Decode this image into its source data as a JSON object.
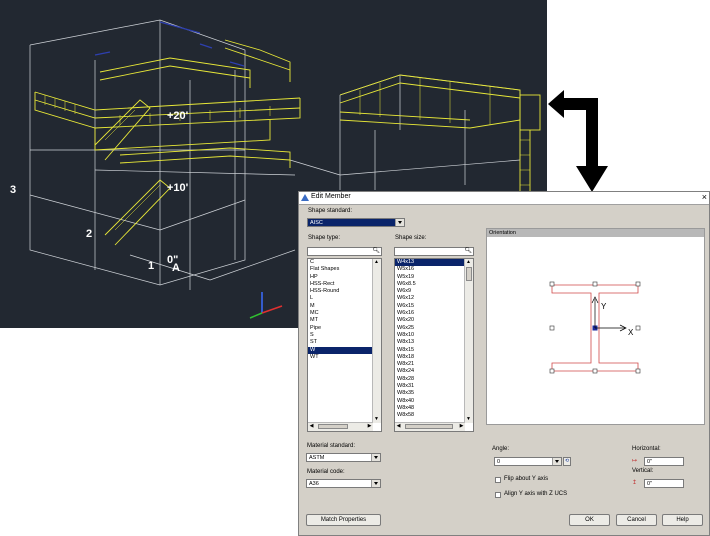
{
  "cad": {
    "labels": {
      "l3": "3",
      "l2": "2",
      "l1": "1",
      "lA": "A",
      "l20": "+20'",
      "l10": "+10'",
      "l0": "0\""
    }
  },
  "dialog": {
    "title": "Edit Member",
    "close": "×",
    "shape_standard_label": "Shape standard:",
    "shape_standard_value": "AISC",
    "shape_type_label": "Shape type:",
    "shape_size_label": "Shape size:",
    "shape_types": [
      "C",
      "Flat Shapes",
      "HP",
      "HSS-Rect",
      "HSS-Round",
      "L",
      "M",
      "MC",
      "MT",
      "Pipe",
      "S",
      "ST",
      "W",
      "WT"
    ],
    "shape_type_selected": "W",
    "shape_sizes": [
      "W4x13",
      "W5x16",
      "W5x19",
      "W6x8.5",
      "W6x9",
      "W6x12",
      "W6x15",
      "W6x16",
      "W6x20",
      "W6x25",
      "W8x10",
      "W8x13",
      "W8x15",
      "W8x18",
      "W8x21",
      "W8x24",
      "W8x28",
      "W8x31",
      "W8x35",
      "W8x40",
      "W8x48",
      "W8x58"
    ],
    "shape_size_selected": "W4x13",
    "orientation_label": "Orientation",
    "axis_y": "Y",
    "axis_x": "X",
    "material_standard_label": "Material standard:",
    "material_standard_value": "ASTM",
    "material_code_label": "Material code:",
    "material_code_value": "A36",
    "angle_label": "Angle:",
    "angle_value": "0",
    "flip_label": "Flip about Y axis",
    "align_label": "Align Y axis with Z UCS",
    "horizontal_label": "Horizontal:",
    "horizontal_value": "0\"",
    "vertical_label": "Vertical:",
    "vertical_value": "0\"",
    "match_button": "Match Properties",
    "ok_button": "OK",
    "cancel_button": "Cancel",
    "help_button": "Help"
  },
  "colors": {
    "cad_bg": "#222831",
    "selection": "#0a246a",
    "rail": "#e8e838",
    "frame": "#ffffff"
  }
}
